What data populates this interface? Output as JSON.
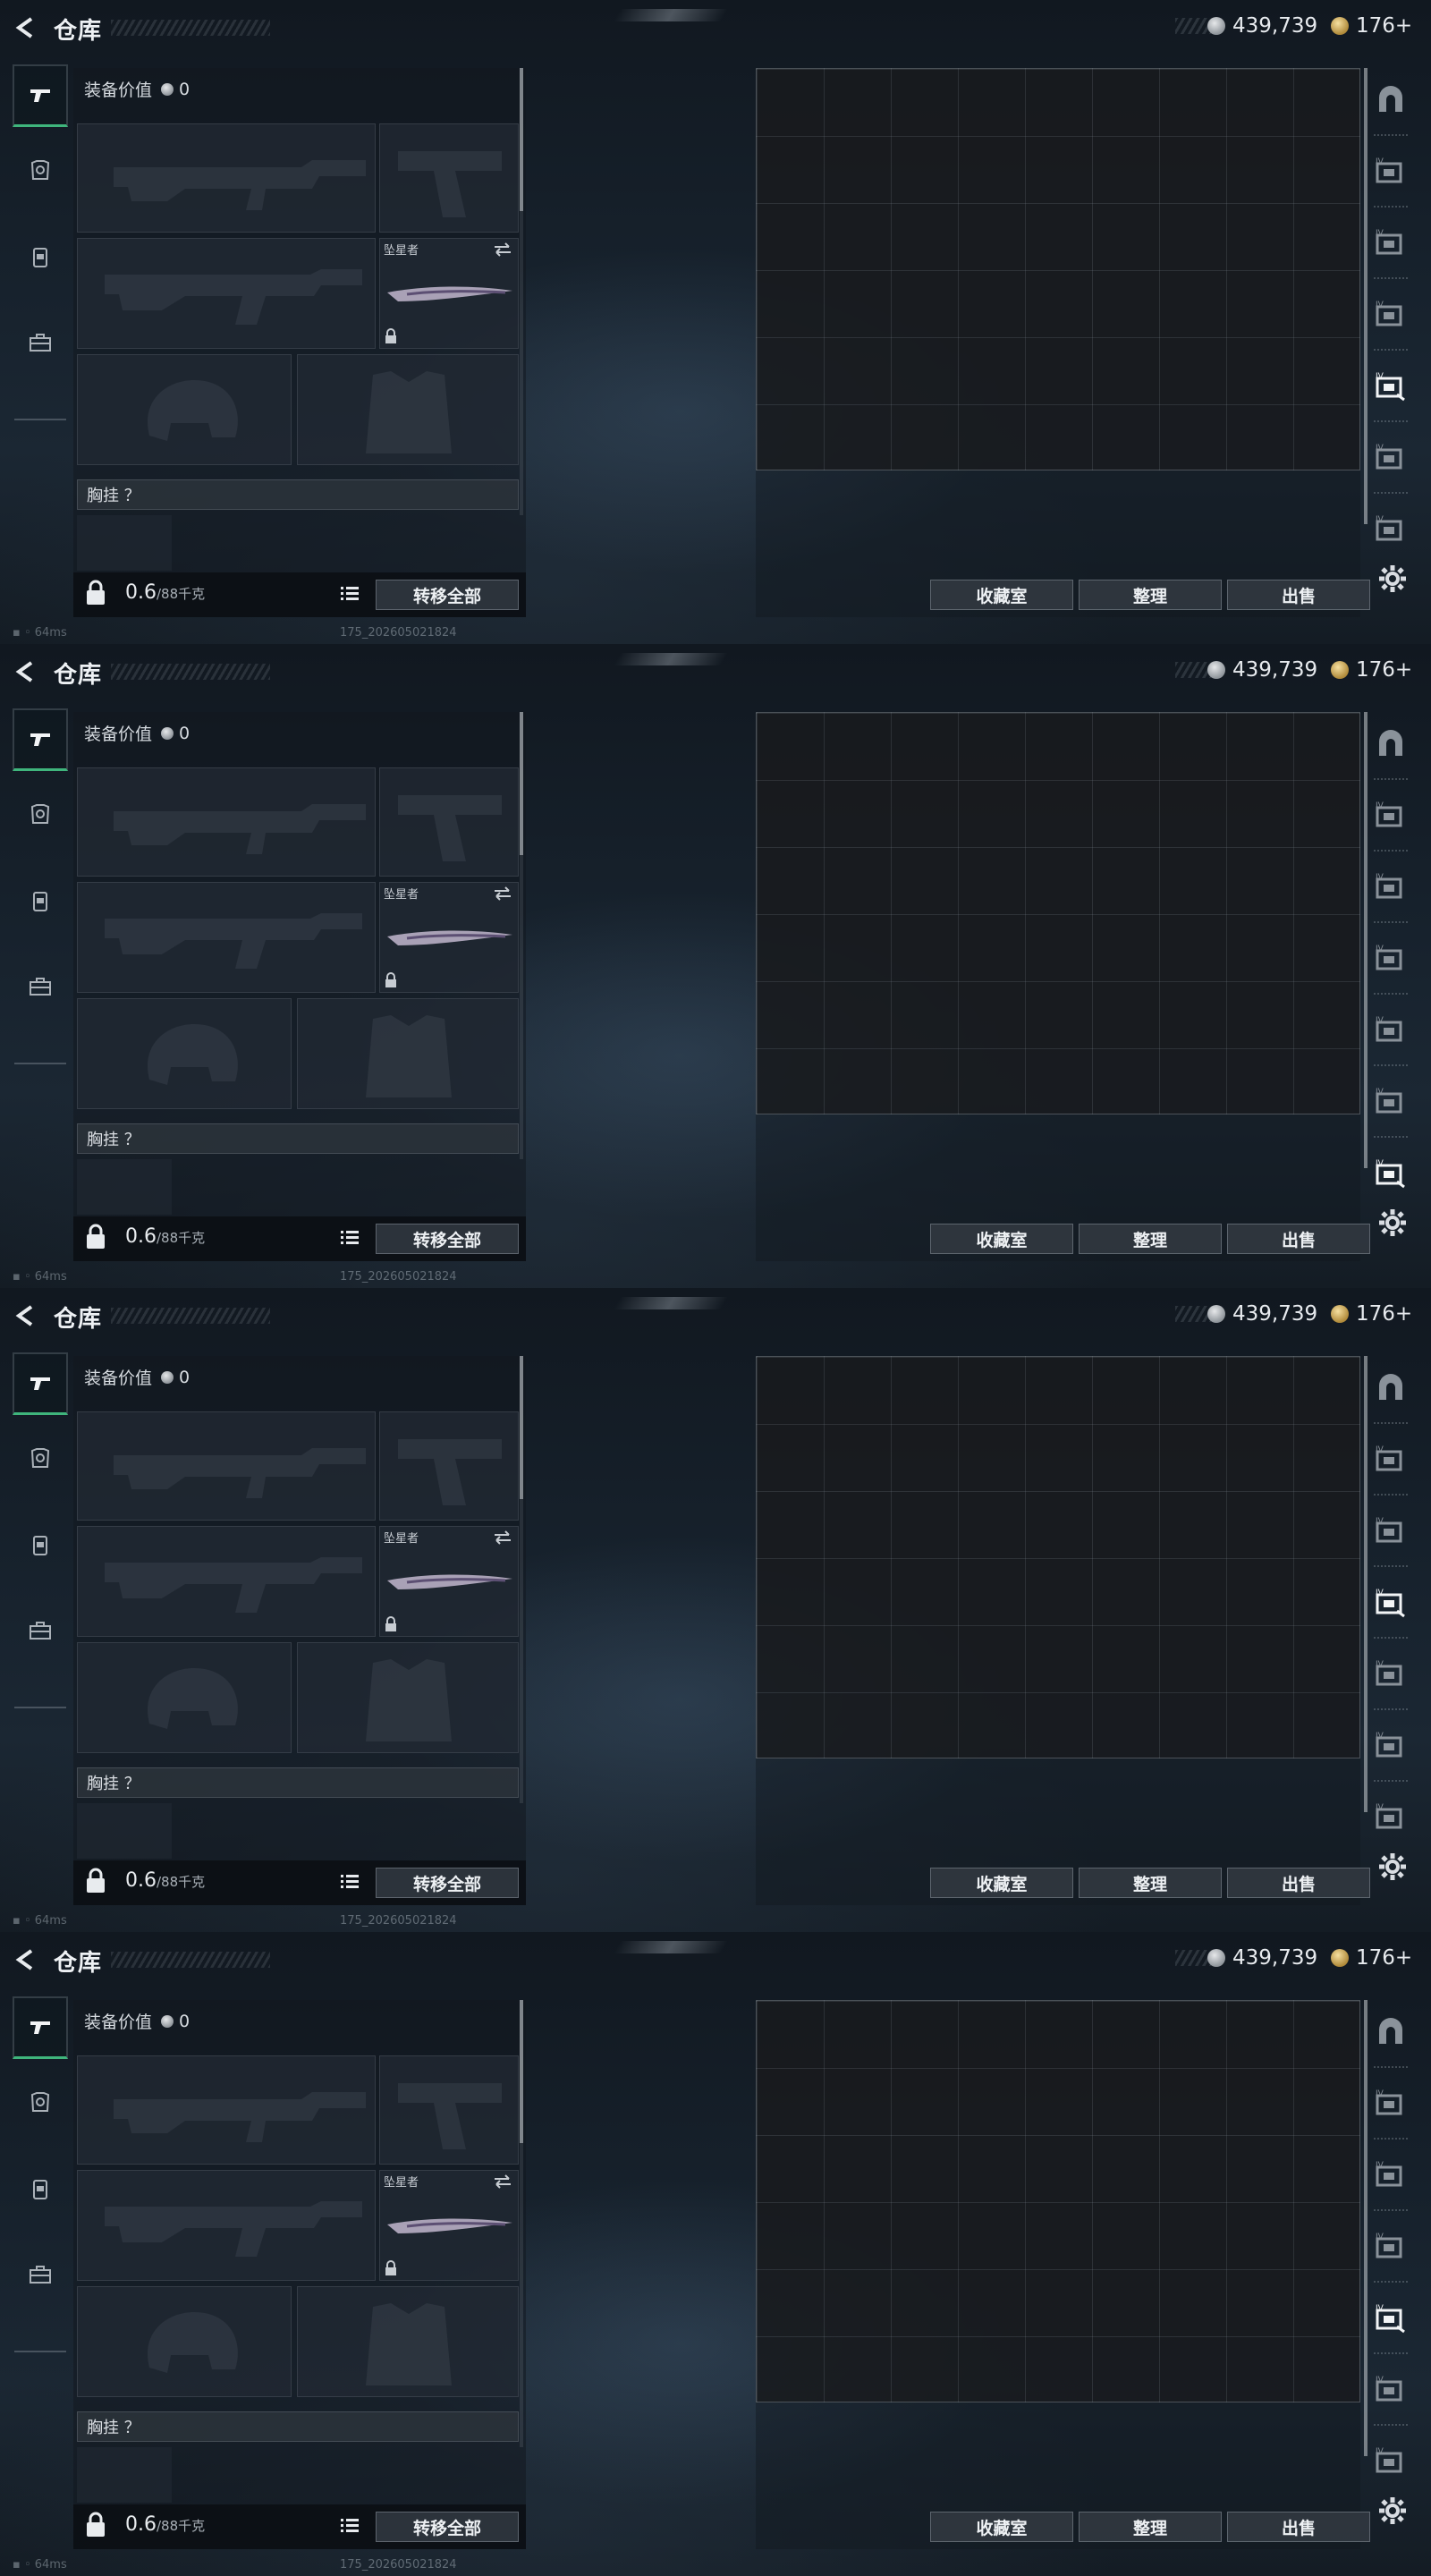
{
  "header": {
    "title": "仓库",
    "silver_amount": "439,739",
    "gold_amount": "176+"
  },
  "equipment": {
    "value_label": "装备价值",
    "value": "0",
    "melee_label": "坠星者",
    "chest_label": "胸挂 ？",
    "weight_value": "0.6",
    "weight_capacity": "/88千克",
    "transfer_all": "转移全部"
  },
  "storage": {
    "collection_button": "收藏室",
    "sort_button": "整理",
    "sell_button": "出售"
  },
  "footer": {
    "ping": "64ms",
    "build": "175_20260502182​4"
  },
  "panels": [
    {
      "active_right_tab": 4
    },
    {
      "active_right_tab": 6
    },
    {
      "active_right_tab": 3
    },
    {
      "active_right_tab": 4
    }
  ],
  "colors": {
    "accent": "#3fb57c",
    "background": "#141c24"
  }
}
